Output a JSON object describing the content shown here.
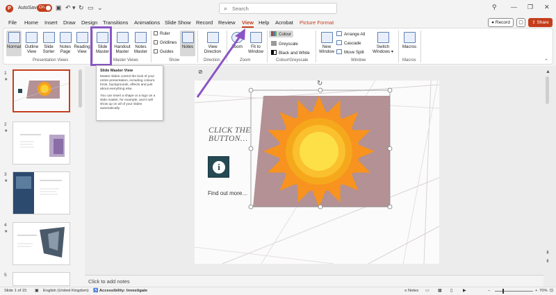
{
  "titlebar": {
    "autosave_label": "AutoSave",
    "autosave_state": "On",
    "search_placeholder": "Search"
  },
  "tabs": [
    "File",
    "Home",
    "Insert",
    "Draw",
    "Design",
    "Transitions",
    "Animations",
    "Slide Show",
    "Record",
    "Review",
    "View",
    "Help",
    "Acrobat",
    "Picture Format"
  ],
  "active_tab": "View",
  "right_buttons": {
    "record": "Record",
    "share": "Share"
  },
  "ribbon": {
    "presentation_views": {
      "label": "Presentation Views",
      "items": [
        "Normal",
        "Outline View",
        "Slide Sorter",
        "Notes Page",
        "Reading View"
      ]
    },
    "master_views": {
      "label": "Master Views",
      "items": [
        "Slide Master",
        "Handout Master",
        "Notes Master"
      ]
    },
    "show": {
      "label": "Show",
      "checks": [
        "Ruler",
        "Gridlines",
        "Guides"
      ],
      "notes": "Notes"
    },
    "direction": {
      "label": "Direction",
      "button": "View Direction"
    },
    "zoom": {
      "label": "Zoom",
      "items": [
        "Zoom",
        "Fit to Window"
      ]
    },
    "colour": {
      "label": "Colour/Greyscale",
      "items": [
        "Colour",
        "Greyscale",
        "Black and White"
      ]
    },
    "window": {
      "label": "Window",
      "new_window": "New Window",
      "items": [
        "Arrange All",
        "Cascade",
        "Move Split"
      ],
      "switch": "Switch Windows"
    },
    "macros": {
      "label": "Macros",
      "button": "Macros"
    }
  },
  "tooltip": {
    "title": "Slide Master View",
    "p1": "Master slides control the look of your entire presentation, including colours, fonts, backgrounds, effects and just about everything else.",
    "p2": "You can insert a shape or a logo on a slide master, for example, and it will show up on all of your slides automatically."
  },
  "thumbnails": [
    {
      "num": "1",
      "active": true
    },
    {
      "num": "2",
      "active": false
    },
    {
      "num": "3",
      "active": false
    },
    {
      "num": "4",
      "active": false
    },
    {
      "num": "5",
      "active": false
    }
  ],
  "slide": {
    "heading_line1": "CLICK THE",
    "heading_line2": "BUTTON…",
    "info_glyph": "i",
    "find_out": "Find out more…"
  },
  "notes_placeholder": "Click to add notes",
  "status": {
    "slide_of": "Slide 1 of 15",
    "language": "English (United Kingdom)",
    "accessibility": "Accessibility: Investigate",
    "notes": "Notes",
    "zoom": "70%"
  },
  "colors": {
    "accent": "#c43e1c",
    "highlight": "#8a55c4"
  }
}
